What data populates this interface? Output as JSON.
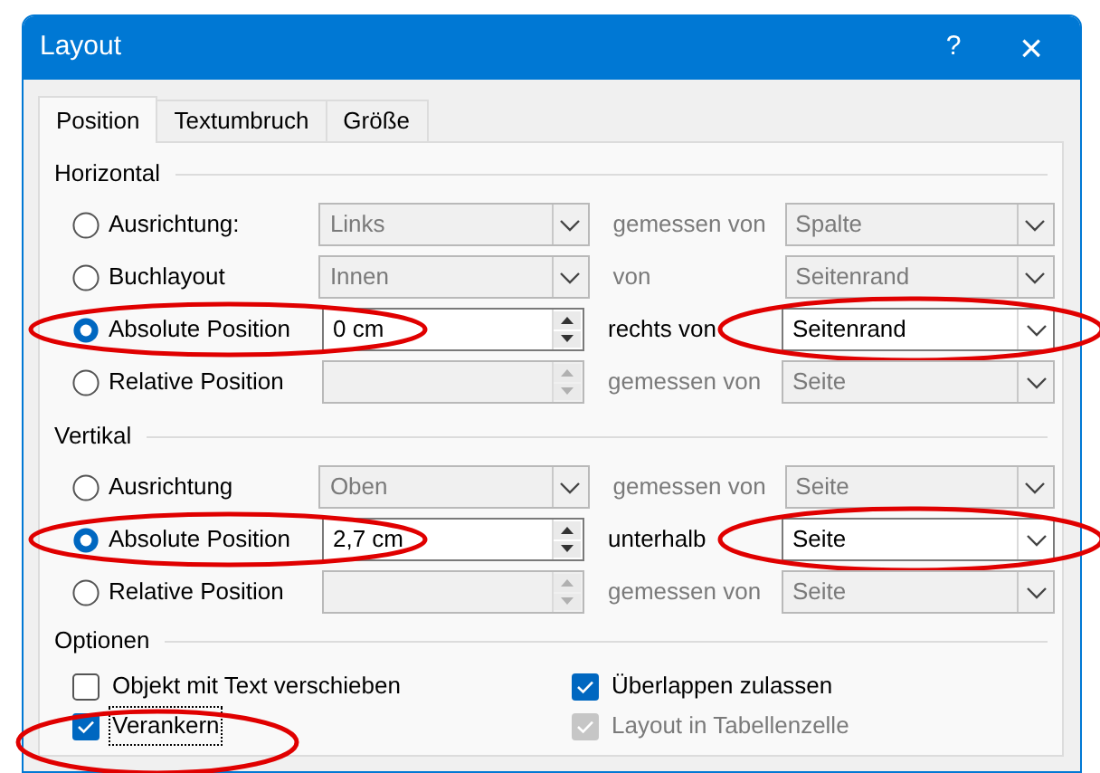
{
  "window": {
    "title": "Layout",
    "help": "?",
    "close": "×"
  },
  "tabs": [
    {
      "label": "Position",
      "selected": true
    },
    {
      "label": "Textumbruch",
      "selected": false
    },
    {
      "label": "Größe",
      "selected": false
    }
  ],
  "sections": [
    {
      "heading": "Horizontal",
      "rows": [
        {
          "label": "Ausrichtung:",
          "selected": false,
          "highlighted": false,
          "control": {
            "kind": "combo",
            "value": "Links",
            "disabled": true
          },
          "relation": {
            "text": "gemessen von",
            "disabled": true
          },
          "reference": {
            "value": "Spalte",
            "disabled": true,
            "highlighted": false
          }
        },
        {
          "label": "Buchlayout",
          "selected": false,
          "highlighted": false,
          "control": {
            "kind": "combo",
            "value": "Innen",
            "disabled": true
          },
          "relation": {
            "text": "von",
            "disabled": true
          },
          "reference": {
            "value": "Seitenrand",
            "disabled": true,
            "highlighted": false
          }
        },
        {
          "label": "Absolute Position",
          "selected": true,
          "highlighted": true,
          "control": {
            "kind": "spin",
            "value": "0 cm",
            "disabled": false
          },
          "relation": {
            "text": "rechts von",
            "disabled": false
          },
          "reference": {
            "value": "Seitenrand",
            "disabled": false,
            "highlighted": true
          }
        },
        {
          "label": "Relative Position",
          "selected": false,
          "highlighted": false,
          "control": {
            "kind": "spin",
            "disabled": true
          },
          "relation": {
            "text": "gemessen von",
            "disabled": true
          },
          "reference": {
            "value": "Seite",
            "disabled": true,
            "highlighted": false
          }
        }
      ]
    },
    {
      "heading": "Vertikal",
      "rows": [
        {
          "label": "Ausrichtung",
          "selected": false,
          "highlighted": false,
          "control": {
            "kind": "combo",
            "value": "Oben",
            "disabled": true
          },
          "relation": {
            "text": "gemessen von",
            "disabled": true
          },
          "reference": {
            "value": "Seite",
            "disabled": true,
            "highlighted": false
          }
        },
        {
          "label": "Absolute Position",
          "selected": true,
          "highlighted": true,
          "control": {
            "kind": "spin",
            "value": "2,7 cm",
            "disabled": false
          },
          "relation": {
            "text": "unterhalb",
            "disabled": false
          },
          "reference": {
            "value": "Seite",
            "disabled": false,
            "highlighted": true
          }
        },
        {
          "label": "Relative Position",
          "selected": false,
          "highlighted": false,
          "control": {
            "kind": "spin",
            "disabled": true
          },
          "relation": {
            "text": "gemessen von",
            "disabled": true
          },
          "reference": {
            "value": "Seite",
            "disabled": true,
            "highlighted": false
          }
        }
      ]
    }
  ],
  "options": {
    "heading": "Optionen",
    "checkboxes": [
      {
        "label": "Objekt mit Text verschieben",
        "checked": false,
        "disabled": false,
        "focused": false,
        "highlighted": false
      },
      {
        "label": "Überlappen zulassen",
        "checked": true,
        "disabled": false,
        "focused": false,
        "highlighted": false
      },
      {
        "label": "Verankern",
        "checked": true,
        "disabled": false,
        "focused": true,
        "highlighted": true
      },
      {
        "label": "Layout in Tabellenzelle",
        "checked": true,
        "disabled": true,
        "focused": false,
        "highlighted": false
      }
    ]
  }
}
